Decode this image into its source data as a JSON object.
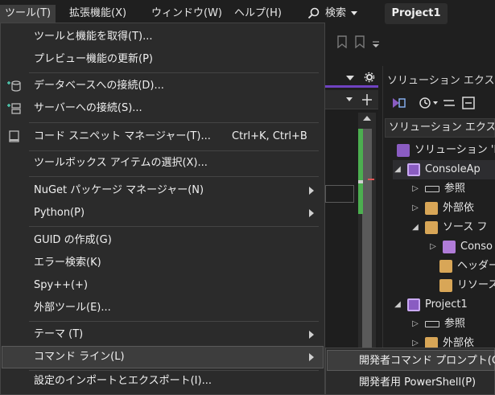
{
  "menubar": {
    "items": [
      "ツール(T)",
      "拡張機能(X)",
      "ウィンドウ(W)",
      "ヘルプ(H)"
    ],
    "search_label": "検索",
    "project_name": "Project1"
  },
  "tools_menu": {
    "items": [
      {
        "label": "ツールと機能を取得(T)..."
      },
      {
        "label": "プレビュー機能の更新(P)"
      },
      {
        "label": "データベースへの接続(D)...",
        "icon": "database-connect-icon"
      },
      {
        "label": "サーバーへの接続(S)...",
        "icon": "server-connect-icon"
      },
      {
        "label": "コード スニペット マネージャー(T)...",
        "icon": "snippet-icon",
        "shortcut": "Ctrl+K, Ctrl+B"
      },
      {
        "label": "ツールボックス アイテムの選択(X)..."
      },
      {
        "label": "NuGet パッケージ マネージャー(N)",
        "submenu": true
      },
      {
        "label": "Python(P)",
        "submenu": true
      },
      {
        "label": "GUID の作成(G)"
      },
      {
        "label": "エラー検索(K)"
      },
      {
        "label": "Spy++(+)"
      },
      {
        "label": "外部ツール(E)..."
      },
      {
        "label": "テーマ (T)",
        "submenu": true
      },
      {
        "label": "コマンド ライン(L)",
        "submenu": true,
        "highlighted": true
      },
      {
        "label": "設定のインポートとエクスポート(I)..."
      }
    ]
  },
  "command_line_submenu": {
    "items": [
      {
        "label": "開発者コマンド プロンプト(C)",
        "highlighted": true
      },
      {
        "label": "開発者用 PowerShell(P)"
      }
    ]
  },
  "solution_explorer": {
    "title": "ソリューション エクスプロ",
    "search_text": "ソリューション エクスプロ",
    "tree": [
      {
        "label": "ソリューション 'Pr",
        "icon": "solution-icon"
      },
      {
        "label": "ConsoleAp",
        "icon": "project-icon",
        "expanded": true
      },
      {
        "label": "参照",
        "icon": "reference-icon"
      },
      {
        "label": "外部依",
        "icon": "folder-icon"
      },
      {
        "label": "ソース フ",
        "icon": "folder-icon",
        "expanded": true
      },
      {
        "label": "Conso",
        "icon": "cpp-file-icon"
      },
      {
        "label": "ヘッダー",
        "icon": "folder-icon"
      },
      {
        "label": "リソース",
        "icon": "folder-icon"
      },
      {
        "label": "Project1",
        "icon": "project-icon",
        "expanded": true
      },
      {
        "label": "参照",
        "icon": "reference-icon"
      },
      {
        "label": "外部依",
        "icon": "folder-icon"
      }
    ]
  },
  "colors": {
    "background": "#1f1f1f",
    "menu_bg": "#2b2b2b",
    "highlight": "#3d3d3d",
    "accent_purple": "#8a5cc2",
    "scroll_green": "#4caf50"
  }
}
